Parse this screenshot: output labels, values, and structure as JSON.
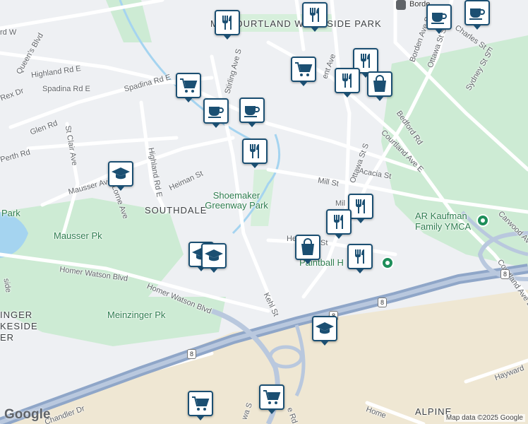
{
  "map": {
    "attribution": "Map data ©2025 Google",
    "logo": "Google",
    "colors": {
      "background": "#eef0f3",
      "park": "#cdebd4",
      "highway": "#8fa6c8",
      "industrial": "#efe7d3",
      "water": "#a5d4f0",
      "pin": "#1b4f72"
    }
  },
  "areas": {
    "courtland_woodside": "MT COURTLAND WOODSIDE PARK",
    "southdale": "SOUTHDALE",
    "alpine": "ALPINE",
    "lakeside": "INGER KESIDE ER"
  },
  "parks": {
    "shoemaker": "Shoemaker Greenway Park",
    "mausser": "Mausser Pk",
    "meinzinger": "Meinzinger Pk",
    "park_west": "Park"
  },
  "places": {
    "ymca": "AR Kaufman Family YMCA",
    "paintball": "Paintball H",
    "borden": "Borde"
  },
  "streets": {
    "highland_rd_e": "Highland Rd E",
    "highland_rd_e_2": "Highland Rd E",
    "rd_w": "rd W",
    "queens_blvd": "Queen's Blvd",
    "spadina_rd_e": "Spadina Rd E",
    "spadina_rd_e_2": "Spadina Rd E",
    "rex_dr": "Rex Dr",
    "glen_rd": "Glen Rd",
    "st_clair_ave": "St Clair Ave",
    "perth_rd": "Perth Rd",
    "stirling_ave_s": "Stirling Ave S",
    "heiman_st": "Heiman St",
    "mausser_ave": "Mausser Ave",
    "lorne_ave": "Lorne Ave",
    "mill_st": "Mill St",
    "mill_st_2": "Mil",
    "acacia_st": "Acacia St",
    "ottawa_st_s": "Ottawa St S",
    "ottawa_st_s_2": "Ottawa St S",
    "courtland_ave_e": "Courtland Ave E",
    "courtland_ave_e_2": "Courtland Ave E",
    "bedford_rd": "Bedford Rd",
    "charles_st_e": "Charles St E",
    "sydney_st_s": "Sydney St S",
    "borden_ave_s": "Borden Ave S",
    "kent_ave": "ent Ave",
    "homer_watson_blvd": "Homer Watson Blvd",
    "homer_watson_blvd_2": "Homer Watson Blvd",
    "kehl_st": "Kehl St",
    "carwood_ave": "Carwood Ave",
    "hayward": "Hayward",
    "chandler_dr": "Chandler Dr",
    "homer": "Home",
    "e_rd": "e Rd",
    "wa_st": "wa S",
    "he_st": "He",
    "st_frag": "St",
    "ide_frag": "side"
  },
  "shields": [
    "8",
    "8",
    "8",
    "8"
  ],
  "pins": [
    {
      "type": "restaurant"
    },
    {
      "type": "restaurant"
    },
    {
      "type": "restaurant"
    },
    {
      "type": "restaurant"
    },
    {
      "type": "restaurant"
    },
    {
      "type": "restaurant"
    },
    {
      "type": "restaurant"
    },
    {
      "type": "restaurant"
    },
    {
      "type": "cafe"
    },
    {
      "type": "cafe"
    },
    {
      "type": "cafe"
    },
    {
      "type": "cafe"
    },
    {
      "type": "grocery"
    },
    {
      "type": "grocery"
    },
    {
      "type": "grocery"
    },
    {
      "type": "grocery"
    },
    {
      "type": "shopping"
    },
    {
      "type": "shopping"
    },
    {
      "type": "school"
    },
    {
      "type": "school"
    },
    {
      "type": "school"
    },
    {
      "type": "school"
    }
  ]
}
